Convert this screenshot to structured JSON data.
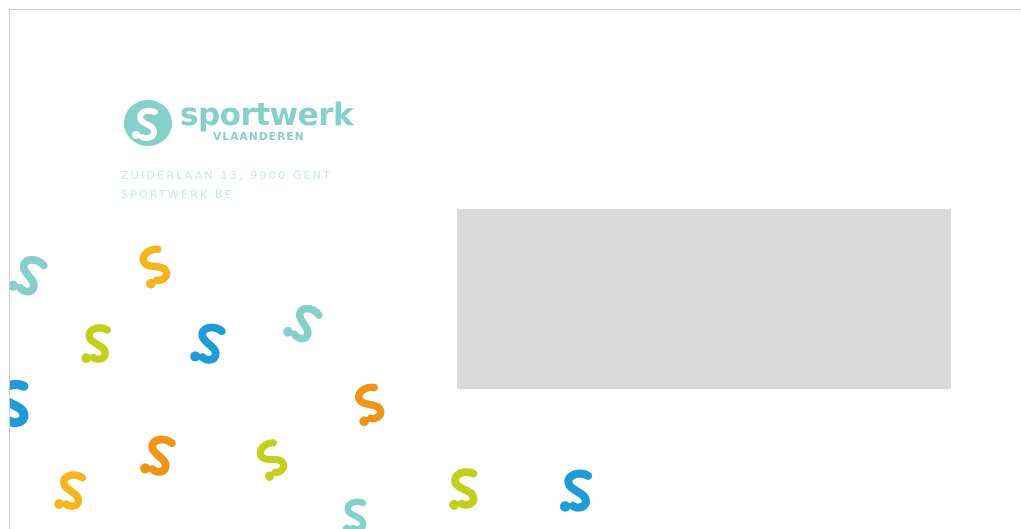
{
  "brand": {
    "name": "sportwerk",
    "subtitle": "VLAANDEREN",
    "color": "#86cfcb"
  },
  "address": {
    "line1": "ZUIDERLAAN 13, 9000 GENT",
    "line2": "SPORTWERK.BE",
    "color": "#c5e8e6"
  },
  "address_window": {
    "color": "#d9d9d9"
  },
  "pattern": {
    "icon": "sportwerk-s-icon",
    "colors": {
      "teal": "#86cfcb",
      "yellow": "#f6b51e",
      "lime": "#c4cf1d",
      "blue": "#1f9bd7",
      "orange": "#f09418"
    }
  }
}
